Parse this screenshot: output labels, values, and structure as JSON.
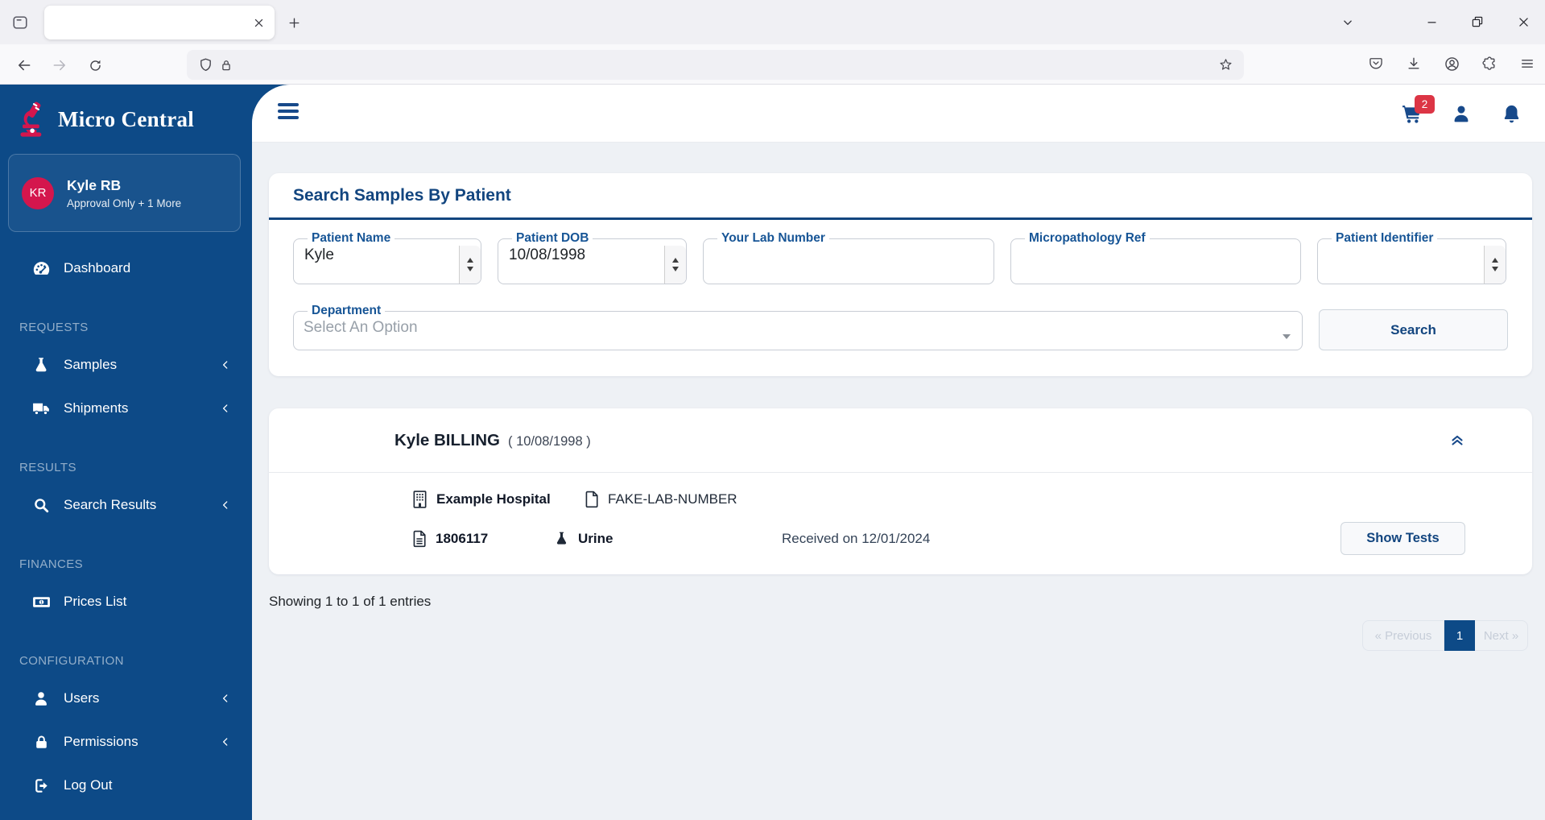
{
  "colors": {
    "navy": "#0d4a87",
    "crimson": "#d4164d",
    "badge_red": "#dc3545",
    "title_blue": "#12457f",
    "page_bg": "#eef1f5"
  },
  "browser": {
    "tab_title": ""
  },
  "sidebar": {
    "brand": "Micro Central",
    "user": {
      "initials": "KR",
      "name": "Kyle RB",
      "role": "Approval Only + 1 More"
    },
    "sections": [
      {
        "header": "",
        "items": [
          {
            "label": "Dashboard"
          }
        ]
      },
      {
        "header": "REQUESTS",
        "items": [
          {
            "label": "Samples"
          },
          {
            "label": "Shipments"
          }
        ]
      },
      {
        "header": "RESULTS",
        "items": [
          {
            "label": "Search Results"
          }
        ]
      },
      {
        "header": "FINANCES",
        "items": [
          {
            "label": "Prices List"
          }
        ]
      },
      {
        "header": "CONFIGURATION",
        "items": [
          {
            "label": "Users"
          },
          {
            "label": "Permissions"
          },
          {
            "label": "Log Out"
          }
        ]
      }
    ]
  },
  "navbar": {
    "cart_badge": "2"
  },
  "search_card": {
    "title": "Search Samples By Patient",
    "fields": [
      {
        "label": "Patient Name",
        "value": "Kyle"
      },
      {
        "label": "Patient DOB",
        "value": "10/08/1998"
      },
      {
        "label": "Your Lab Number",
        "value": ""
      },
      {
        "label": "Micropathology Ref",
        "value": ""
      },
      {
        "label": "Patient Identifier",
        "value": ""
      }
    ],
    "department": {
      "label": "Department",
      "value": "Select An Option"
    },
    "search_button": "Search"
  },
  "results": {
    "patient_name": "Kyle BILLING",
    "patient_dob": "( 10/08/1998 )",
    "hospital": "Example Hospital",
    "lab_number": "FAKE-LAB-NUMBER",
    "sample_id": "1806117",
    "sample_type": "Urine",
    "received": "Received on 12/01/2024",
    "show_tests_button": "Show Tests"
  },
  "footer": {
    "entries_text": "Showing 1 to 1 of 1 entries",
    "pagination": {
      "previous": "« Previous",
      "page": "1",
      "next": "Next »"
    }
  }
}
